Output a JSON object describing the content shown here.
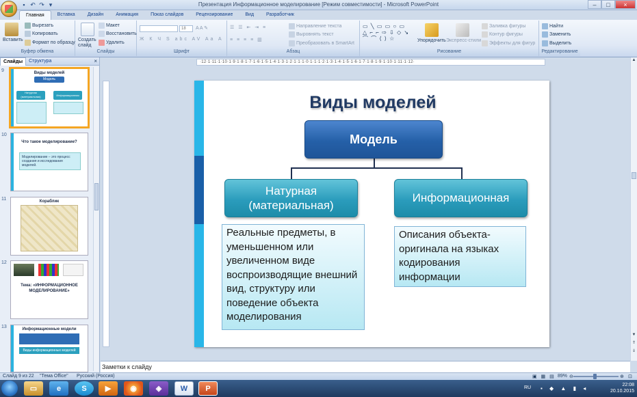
{
  "window": {
    "title": "Презентация Информационное моделирование [Режим совместимости] - Microsoft PowerPoint",
    "controls": [
      "–",
      "□",
      "×"
    ]
  },
  "ribbon_tabs": [
    "Главная",
    "Вставка",
    "Дизайн",
    "Анимация",
    "Показ слайдов",
    "Рецензирование",
    "Вид",
    "Разработчик"
  ],
  "ribbon": {
    "clipboard": {
      "paste": "Вставить",
      "cut": "Вырезать",
      "copy": "Копировать",
      "format_painter": "Формат по образцу",
      "label": "Буфер обмена"
    },
    "slides": {
      "new_slide": "Создать слайд",
      "layout": "Макет",
      "reset": "Восстановить",
      "delete": "Удалить",
      "label": "Слайды"
    },
    "font": {
      "label": "Шрифт",
      "size": "18"
    },
    "paragraph": {
      "text_direction": "Направление текста",
      "align_text": "Выровнять текст",
      "smartart": "Преобразовать в SmartArt",
      "label": "Абзац"
    },
    "drawing": {
      "arrange": "Упорядочить",
      "quick_styles": "Экспресс-стили",
      "fill": "Заливка фигуры",
      "outline": "Контур фигуры",
      "effects": "Эффекты для фигур",
      "label": "Рисование",
      "shapes": "▭ ╲ ▭ ▭ ○ ▭ △ ⌐ ⌐ ⇨ ⇩ ◇ ↘ ⌒ ⌒ ⟨ ⟩ ☆"
    },
    "editing": {
      "find": "Найти",
      "replace": "Заменить",
      "select": "Выделить",
      "label": "Редактирование"
    }
  },
  "panel": {
    "tabs": [
      "Слайды",
      "Структура"
    ],
    "close": "×",
    "thumbnails": [
      {
        "num": "9",
        "title": "Виды моделей",
        "lines": [
          "Модель",
          "Натурная (материальная)",
          "Информационная"
        ]
      },
      {
        "num": "10",
        "title": "Что такое моделирование?",
        "lines": [
          "Моделирование – это процесс создания и исследования моделей."
        ]
      },
      {
        "num": "11",
        "title": "Кораблик",
        "lines": []
      },
      {
        "num": "12",
        "title": "Тема: «ИНФОРМАЦИОННОЕ МОДЕЛИРОВАНИЕ»",
        "lines": []
      },
      {
        "num": "13",
        "title": "Информационные модели",
        "lines": [
          "Виды информационных моделей"
        ]
      }
    ]
  },
  "slide": {
    "title": "Виды моделей",
    "root": "Модель",
    "left_node": "Натурная (материальная)",
    "right_node": "Информационная",
    "left_desc": "Реальные предметы, в уменьшенном или увеличенном виде воспроизводящие внешний вид, структуру или поведение объекта моделирования",
    "right_desc": "Описания объекта-оригинала на языках кодирования информации"
  },
  "ruler": "·12·1·11·1·10·1·9·1·8·1·7·1·6·1·5·1·4·1·3·1·2·1·1·1·0·1·1·1·2·1·3·1·4·1·5·1·6·1·7·1·8·1·9·1·10·1·11·1·12·",
  "notes_placeholder": "Заметки к слайду",
  "status": {
    "slide": "Слайд 9 из 22",
    "theme": "\"Тема Office\"",
    "language": "Русский (Россия)",
    "zoom": "89%"
  },
  "taskbar": {
    "lang": "RU",
    "time": "22:08",
    "date": "20.10.2015"
  }
}
